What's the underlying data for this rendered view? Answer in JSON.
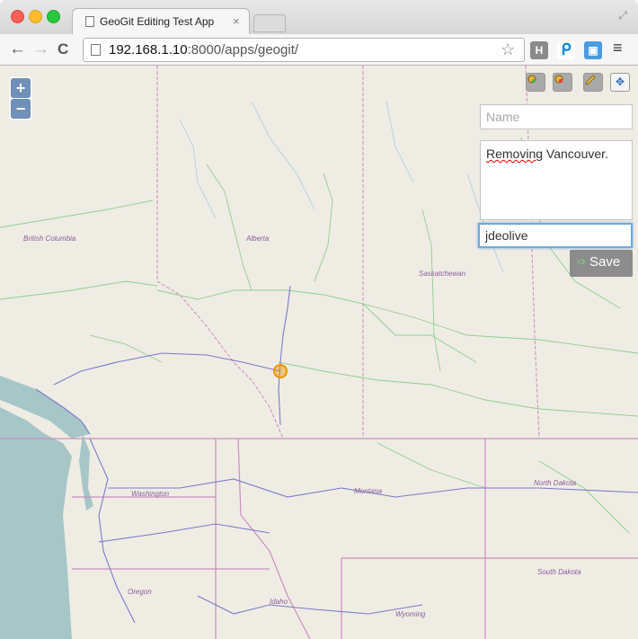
{
  "browser": {
    "tab_title": "GeoGit Editing Test App",
    "tab_close": "×",
    "url_host": "192.168.1.10",
    "url_rest": ":8000/apps/geogit/",
    "back_glyph": "←",
    "forward_glyph": "→",
    "reload_glyph": "C",
    "star_glyph": "☆",
    "ext_h": "H",
    "ext_p": "ᑭ",
    "menu_glyph": "≡"
  },
  "map": {
    "zoom_in": "+",
    "zoom_out": "−",
    "labels": {
      "british_columbia": "British Columbia",
      "alberta": "Alberta",
      "saskatchewan": "Saskatchewan",
      "washington": "Washington",
      "montana": "Montana",
      "north_dakota": "North Dakota",
      "south_dakota": "South Dakota",
      "oregon": "Oregon",
      "idaho": "Idaho",
      "wyoming": "Wyoming"
    }
  },
  "editor": {
    "name_placeholder": "Name",
    "message_prefix": "Removing",
    "message_rest": " Vancouver.",
    "author_value": "jdeolive",
    "save_label": "Save",
    "save_icon": "➩",
    "tool_move": "✥"
  },
  "colors": {
    "map_bg": "#efece4",
    "water": "#a6c6c8",
    "border": "#c98fbf",
    "roads": "#8fcf8f",
    "highway": "#7a7acb",
    "marker": "#e89500"
  }
}
